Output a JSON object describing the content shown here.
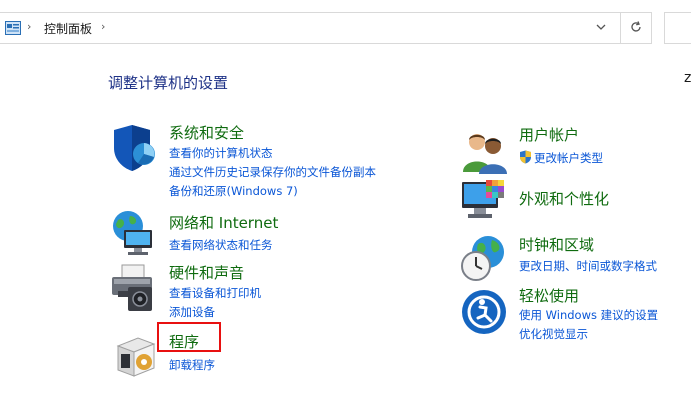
{
  "address_bar": {
    "breadcrumb": "控制面板",
    "separator": "›"
  },
  "search": {
    "partial_char": "z"
  },
  "page_heading": "调整计算机的设置",
  "categories_left": [
    {
      "title": "系统和安全",
      "icon": "shield-icon",
      "links": [
        "查看你的计算机状态",
        "通过文件历史记录保存你的文件备份副本",
        "备份和还原(Windows 7)"
      ]
    },
    {
      "title": "网络和 Internet",
      "icon": "network-globe-icon",
      "links": [
        "查看网络状态和任务"
      ]
    },
    {
      "title": "硬件和声音",
      "icon": "printer-speaker-icon",
      "links": [
        "查看设备和打印机",
        "添加设备"
      ]
    },
    {
      "title": "程序",
      "icon": "programs-icon",
      "links": [
        "卸载程序"
      ]
    }
  ],
  "categories_right": [
    {
      "title": "用户帐户",
      "icon": "users-icon",
      "links": [
        "更改帐户类型"
      ]
    },
    {
      "title": "外观和个性化",
      "icon": "monitor-palette-icon",
      "links": []
    },
    {
      "title": "时钟和区域",
      "icon": "clock-globe-icon",
      "links": [
        "更改日期、时间或数字格式"
      ]
    },
    {
      "title": "轻松使用",
      "icon": "ease-of-access-icon",
      "links": [
        "使用 Windows 建议的设置",
        "优化视觉显示"
      ]
    }
  ],
  "colors": {
    "category_title": "#0f6b0f",
    "link": "#0a56d6",
    "heading": "#1e3287",
    "highlight_box": "#e81010"
  }
}
